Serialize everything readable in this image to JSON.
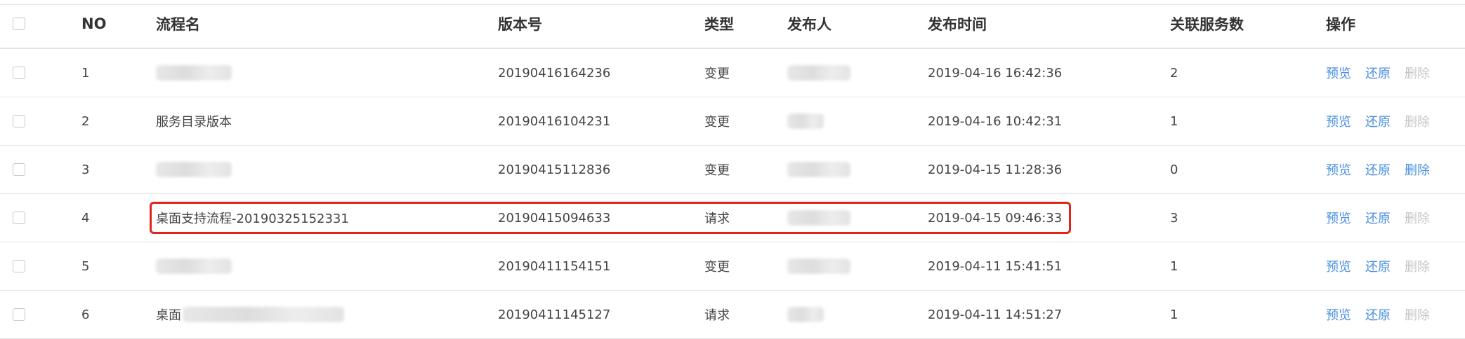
{
  "table": {
    "columns": {
      "no": "NO",
      "name": "流程名",
      "version": "版本号",
      "type": "类型",
      "publisher": "发布人",
      "publish_time": "发布时间",
      "service_count": "关联服务数",
      "operations": "操作"
    },
    "actions": {
      "preview": "预览",
      "restore": "还原",
      "delete": "删除"
    },
    "rows": [
      {
        "no": "1",
        "name": "",
        "version": "20190416164236",
        "type": "变更",
        "publisher": "",
        "time": "2019-04-16 16:42:36",
        "services": "2",
        "delete_enabled": false
      },
      {
        "no": "2",
        "name": "服务目录版本",
        "version": "20190416104231",
        "type": "变更",
        "publisher": "",
        "time": "2019-04-16 10:42:31",
        "services": "1",
        "delete_enabled": false
      },
      {
        "no": "3",
        "name": "",
        "version": "20190415112836",
        "type": "变更",
        "publisher": "",
        "time": "2019-04-15 11:28:36",
        "services": "0",
        "delete_enabled": true
      },
      {
        "no": "4",
        "name": "桌面支持流程-20190325152331",
        "version": "20190415094633",
        "type": "请求",
        "publisher": "",
        "time": "2019-04-15 09:46:33",
        "services": "3",
        "delete_enabled": false
      },
      {
        "no": "5",
        "name": "",
        "version": "20190411154151",
        "type": "变更",
        "publisher": "",
        "time": "2019-04-11 15:41:51",
        "services": "1",
        "delete_enabled": false
      },
      {
        "no": "6",
        "name": "桌面",
        "version": "20190411145127",
        "type": "请求",
        "publisher": "",
        "time": "2019-04-11 14:51:27",
        "services": "1",
        "delete_enabled": false
      }
    ]
  },
  "colors": {
    "link": "#4a90e2",
    "disabled": "#c6c6c6",
    "highlight": "#e0241a"
  }
}
